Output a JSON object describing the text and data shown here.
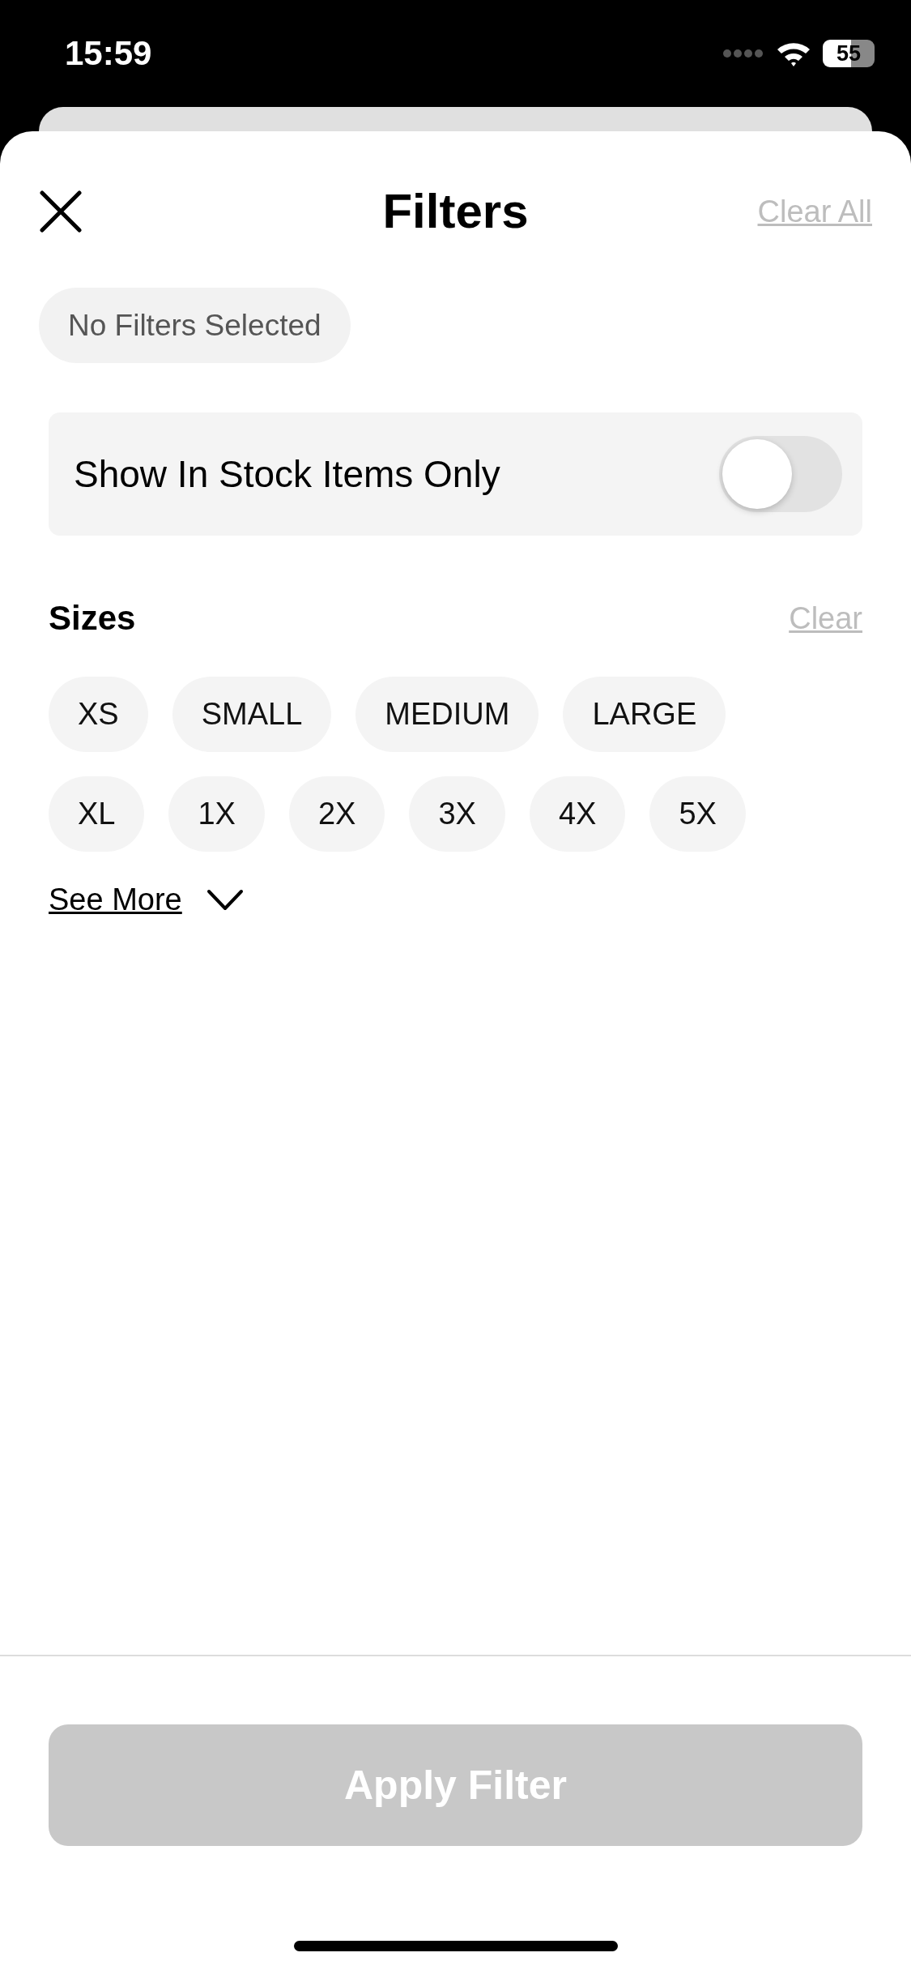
{
  "status_bar": {
    "time": "15:59",
    "battery": "55"
  },
  "header": {
    "title": "Filters",
    "clear_all": "Clear All"
  },
  "summary_chip": "No Filters Selected",
  "in_stock": {
    "label": "Show In Stock Items Only",
    "on": false
  },
  "sizes": {
    "title": "Sizes",
    "clear": "Clear",
    "options": [
      {
        "label": "XS",
        "selected": false
      },
      {
        "label": "SMALL",
        "selected": false
      },
      {
        "label": "MEDIUM",
        "selected": false
      },
      {
        "label": "LARGE",
        "selected": false
      },
      {
        "label": "XL",
        "selected": false
      },
      {
        "label": "1X",
        "selected": false
      },
      {
        "label": "2X",
        "selected": false
      },
      {
        "label": "3X",
        "selected": false
      },
      {
        "label": "4X",
        "selected": false
      },
      {
        "label": "5X",
        "selected": false
      }
    ],
    "see_more": "See More",
    "expanded": false
  },
  "apply_button": {
    "label": "Apply Filter",
    "disabled": true
  }
}
